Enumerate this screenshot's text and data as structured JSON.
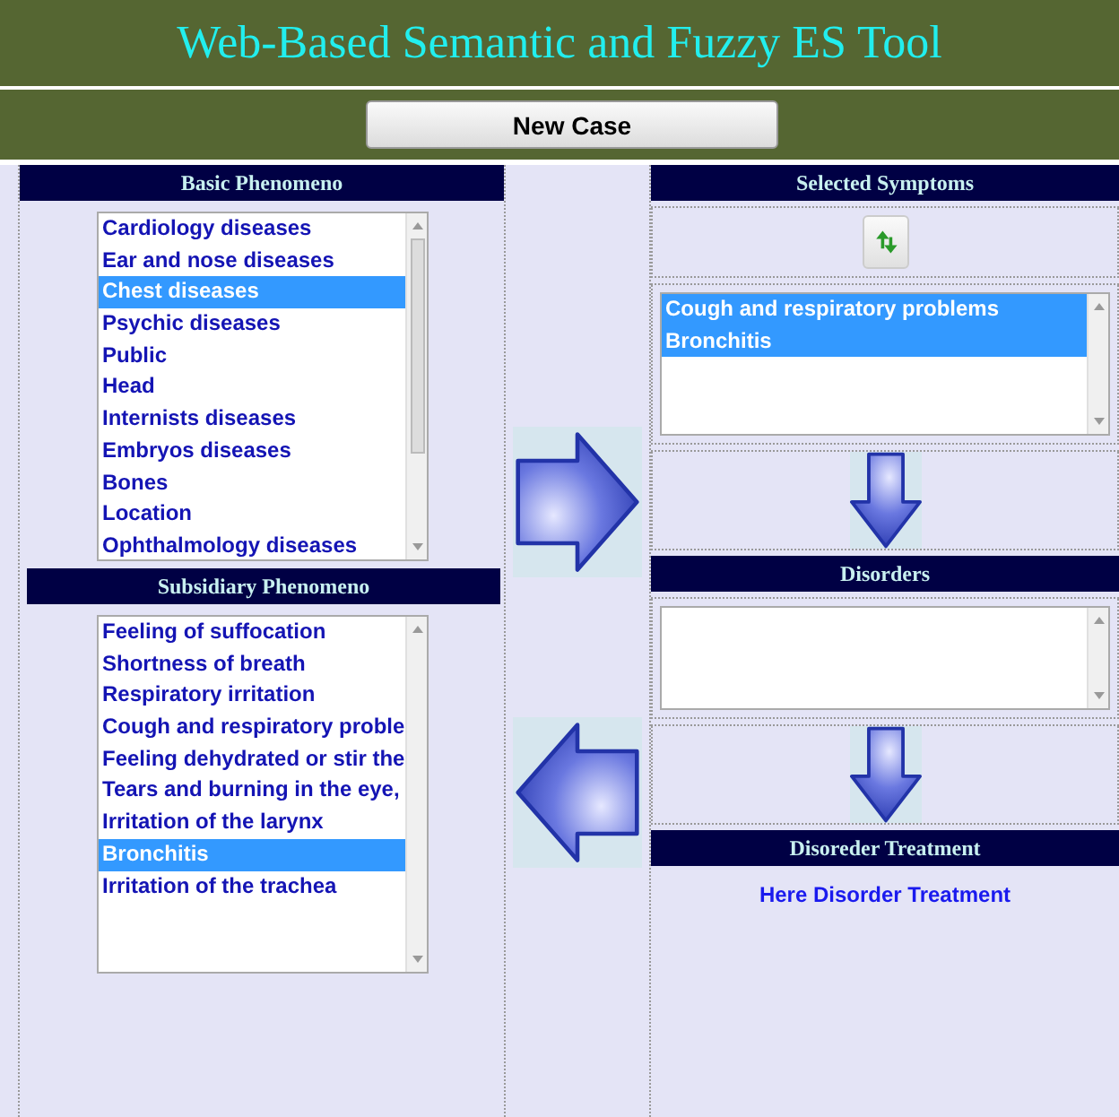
{
  "header": {
    "title": "Web-Based Semantic and Fuzzy ES Tool"
  },
  "toolbar": {
    "new_case_button": "New Case"
  },
  "basic_phenomeno": {
    "title": "Basic Phenomeno",
    "items": [
      {
        "label": "Cardiology diseases",
        "selected": false
      },
      {
        "label": "Ear and nose diseases",
        "selected": false
      },
      {
        "label": "Chest diseases",
        "selected": true
      },
      {
        "label": "Psychic diseases",
        "selected": false
      },
      {
        "label": "Public",
        "selected": false
      },
      {
        "label": "Head",
        "selected": false
      },
      {
        "label": "Internists diseases",
        "selected": false
      },
      {
        "label": "Embryos diseases",
        "selected": false
      },
      {
        "label": "Bones",
        "selected": false
      },
      {
        "label": "Location",
        "selected": false
      },
      {
        "label": "Ophthalmology diseases",
        "selected": false
      }
    ]
  },
  "subsidiary_phenomeno": {
    "title": "Subsidiary Phenomeno",
    "items": [
      {
        "label": "Feeling of suffocation",
        "selected": false
      },
      {
        "label": "Shortness of breath",
        "selected": false
      },
      {
        "label": "Respiratory irritation",
        "selected": false
      },
      {
        "label": "Cough and respiratory proble",
        "selected": false
      },
      {
        "label": "Feeling dehydrated or stir the",
        "selected": false
      },
      {
        "label": "Tears and burning in the eye,",
        "selected": false
      },
      {
        "label": "Irritation of the larynx",
        "selected": false
      },
      {
        "label": "Bronchitis",
        "selected": true
      },
      {
        "label": "Irritation of the trachea",
        "selected": false
      }
    ]
  },
  "selected_symptoms": {
    "title": "Selected Symptoms",
    "items": [
      {
        "label": "Cough and respiratory problems",
        "selected": true
      },
      {
        "label": "Bronchitis",
        "selected": true
      }
    ]
  },
  "disorders": {
    "title": "Disorders"
  },
  "treatment": {
    "title": "Disoreder Treatment",
    "text": "Here Disorder Treatment"
  }
}
